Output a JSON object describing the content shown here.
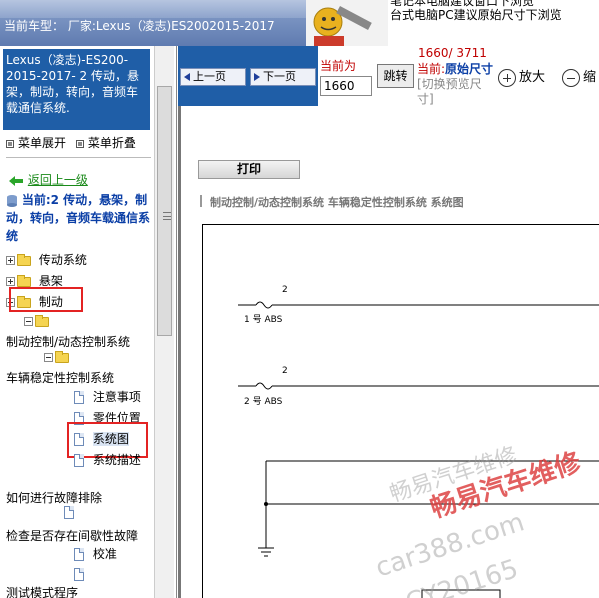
{
  "topbar": {
    "car_info": "当前车型： 厂家:Lexus（凌志)ES2002015-2017"
  },
  "ad": {
    "line1": "笔记本电脑建议窗口下浏览",
    "line2": "台式电脑PC建议原始尺寸下浏览"
  },
  "sidebar": {
    "title": "Lexus（凌志)-ES200-2015-2017- 2 传动，悬架，制动，转向，音频车载通信系统.",
    "menu_expand": "菜单展开",
    "menu_collapse": "菜单折叠",
    "back_link": "返回上一级",
    "current_label": "当前:2 传动，悬架，制动，转向，音频车载通信系统",
    "items": [
      {
        "label": "传动系统"
      },
      {
        "label": "悬架"
      },
      {
        "label": "制动"
      },
      {
        "label": "制动控制/动态控制系统"
      },
      {
        "label": "车辆稳定性控制系统"
      },
      {
        "label": "注意事项"
      },
      {
        "label": "零件位置"
      },
      {
        "label": "系统图"
      },
      {
        "label": "系统描述"
      },
      {
        "label": "如何进行故障排除"
      },
      {
        "label": "检查是否存在间歇性故障"
      },
      {
        "label": "校准"
      },
      {
        "label": "测试模式程序"
      }
    ]
  },
  "toolbar": {
    "prev_label": "上一页",
    "next_label": "下一页",
    "current_page_label": "当前为",
    "page_value": "1660",
    "jump_label": "跳转",
    "page_count": "1660/ 3711",
    "mode_prefix": "当前:",
    "mode_value": "原始尺寸",
    "mode_switch": "[切换预览尺寸]",
    "zoom_in_label": "放大",
    "zoom_out_label": "缩"
  },
  "content": {
    "print_label": "打印",
    "breadcrumb": "制动控制/动态控制系统  车辆稳定性控制系统  系统图",
    "wiring": {
      "fuse1_pin": "2",
      "fuse1_label": "1 号 ABS",
      "fuse2_pin": "2",
      "fuse2_label": "2 号 ABS"
    }
  },
  "watermark": {
    "brand": "畅易汽车维修",
    "site": "car388.com",
    "code": "CY20165"
  },
  "colors": {
    "sidebar_title_bg": "#1f5ea7",
    "highlight": "#e32323",
    "link_green": "#1a8a1a",
    "current_blue": "#0b3fa6",
    "page_red": "#c00000"
  }
}
